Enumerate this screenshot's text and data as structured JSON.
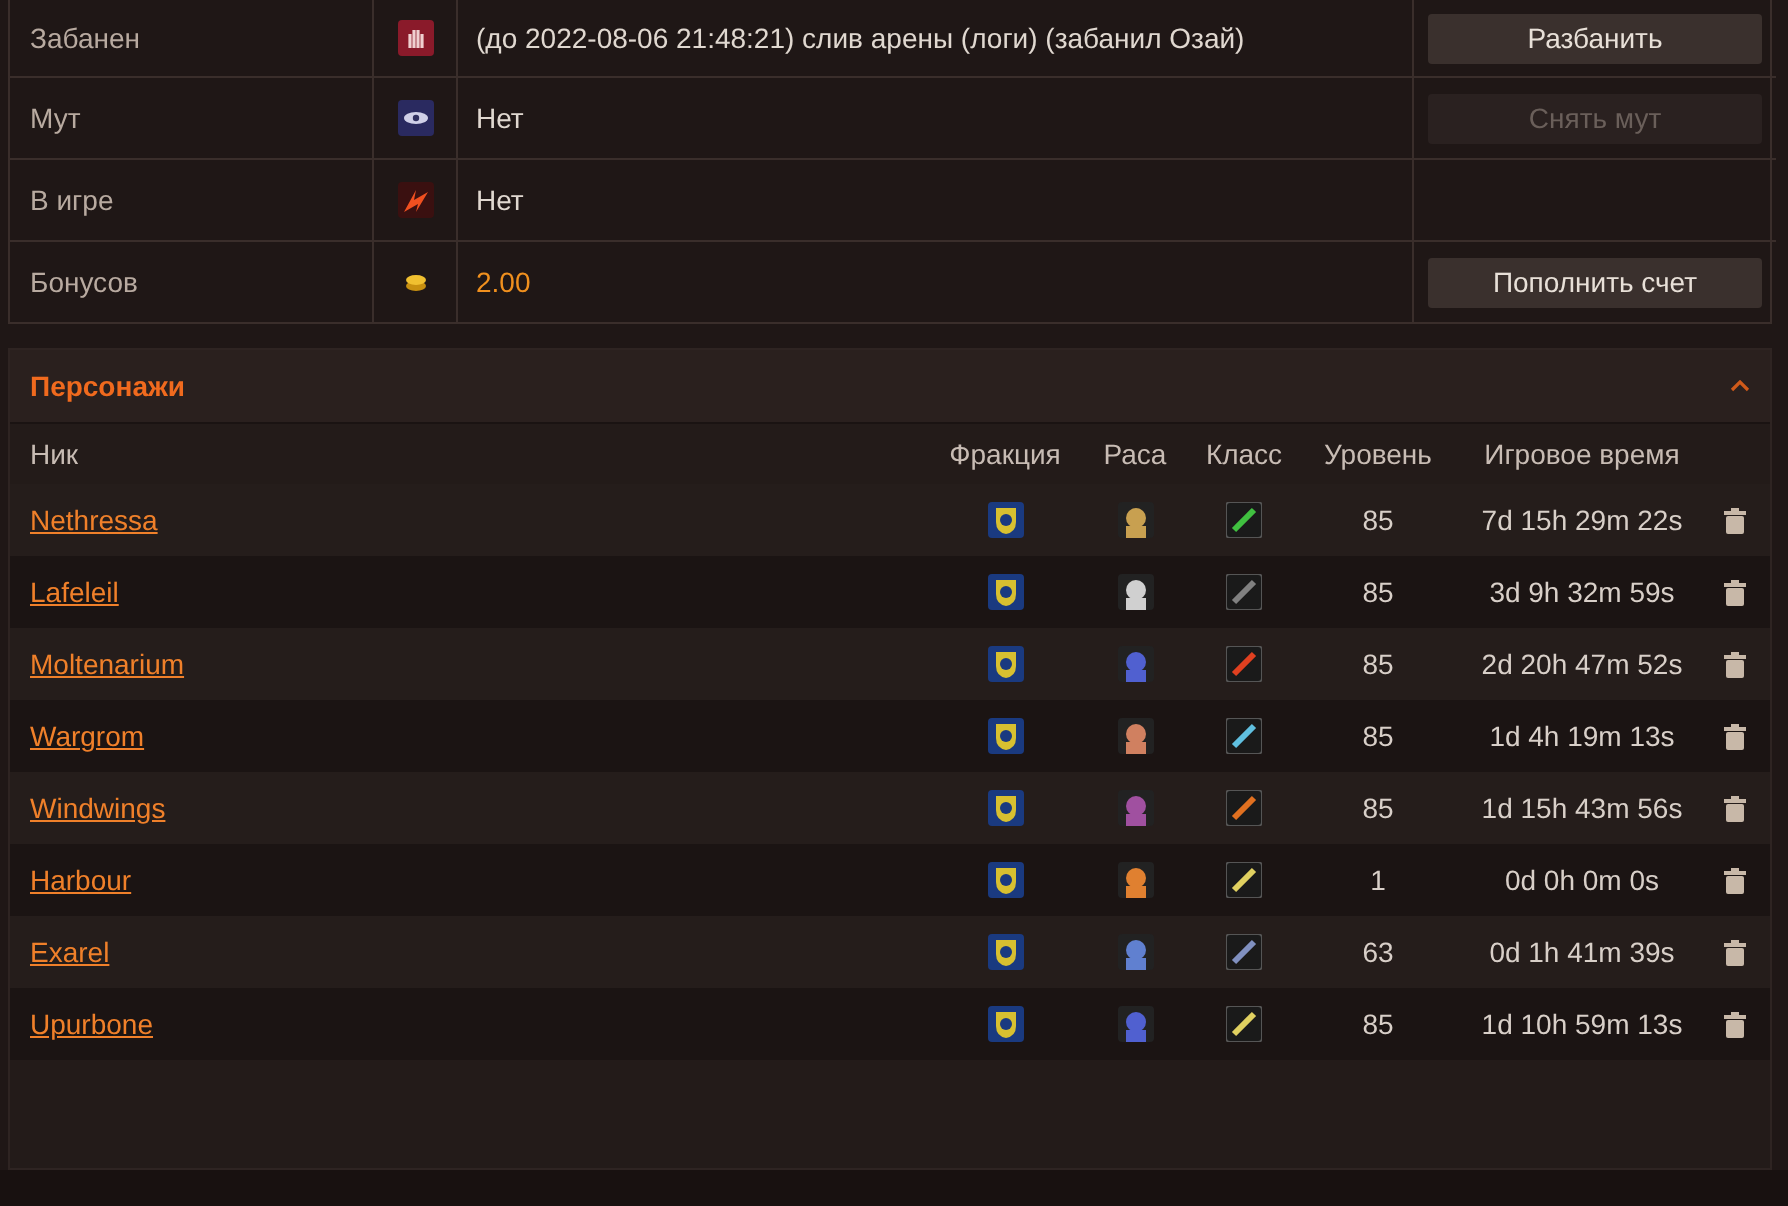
{
  "account": [
    {
      "kind": "ban",
      "label": "Забанен",
      "value": "(до 2022-08-06 21:48:21) слив арены (логи) (забанил Озай)",
      "action": {
        "label": "Разбанить",
        "disabled": false
      }
    },
    {
      "kind": "mute",
      "label": "Мут",
      "value": "Нет",
      "action": {
        "label": "Снять мут",
        "disabled": true
      }
    },
    {
      "kind": "online",
      "label": "В игре",
      "value": "Нет"
    },
    {
      "kind": "bonus",
      "label": "Бонусов",
      "value": "2.00",
      "action": {
        "label": "Пополнить счет",
        "disabled": false
      }
    }
  ],
  "characters": {
    "title": "Персонажи",
    "expanded": true,
    "columns": [
      "Ник",
      "Фракция",
      "Раса",
      "Класс",
      "Уровень",
      "Игровое время"
    ],
    "rows": [
      {
        "name": "Nethressa",
        "level": "85",
        "time": "7d 15h 29m 22s"
      },
      {
        "name": "Lafeleil",
        "level": "85",
        "time": "3d 9h 32m 59s"
      },
      {
        "name": "Moltenarium",
        "level": "85",
        "time": "2d 20h 47m 52s"
      },
      {
        "name": "Wargrom",
        "level": "85",
        "time": "1d 4h 19m 13s"
      },
      {
        "name": "Windwings",
        "level": "85",
        "time": "1d 15h 43m 56s"
      },
      {
        "name": "Harbour",
        "level": "1",
        "time": "0d 0h 0m 0s"
      },
      {
        "name": "Exarel",
        "level": "63",
        "time": "0d 1h 41m 39s"
      },
      {
        "name": "Upurbone",
        "level": "85",
        "time": "1d 10h 59m 13s"
      }
    ]
  }
}
